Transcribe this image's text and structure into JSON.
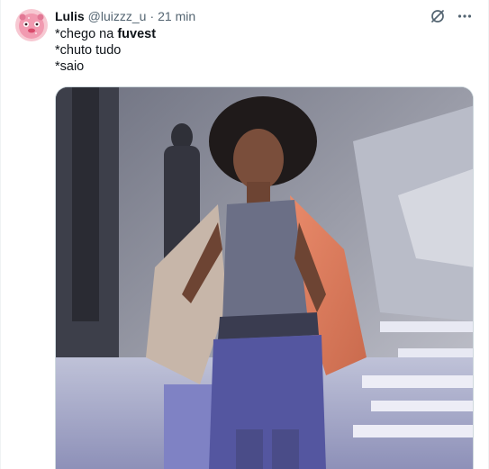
{
  "tweet": {
    "author": {
      "display_name": "Lulis",
      "handle": "@luizzz_u",
      "time": "21 min"
    },
    "text": {
      "line1_prefix": "*chego na ",
      "line1_bold": "fuvest",
      "line2": "*chuto tudo",
      "line3": "*saio"
    },
    "separator": "·",
    "icons": {
      "avatar": "avatar-pink-cartoon",
      "grok": "grok-icon",
      "more": "more-icon"
    },
    "media": {
      "type": "gif",
      "subject": "woman-in-orange-shawl-dancing"
    }
  },
  "colors": {
    "text_primary": "#0f1419",
    "text_secondary": "#536471",
    "border": "#eff3f4",
    "avatar_pink": "#f4a6b8"
  }
}
